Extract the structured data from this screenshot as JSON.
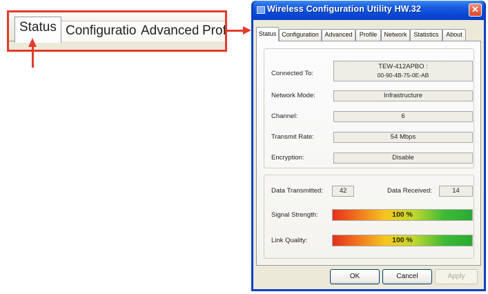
{
  "zoom": {
    "tabs": [
      "Status",
      "Configuration",
      "Advanced",
      "Profi"
    ]
  },
  "window": {
    "title": "Wireless Configuration Utility HW.32",
    "close_glyph": "✕",
    "tabs": [
      "Status",
      "Configuration",
      "Advanced",
      "Profile",
      "Network",
      "Statistics",
      "About"
    ],
    "active_tab": "Status"
  },
  "status": {
    "connected_to_label": "Connected To:",
    "connected_to_line1": "TEW-412APBO :",
    "connected_to_line2": "00-90-4B-75-0E-AB",
    "network_mode_label": "Network Mode:",
    "network_mode": "Infrastructure",
    "channel_label": "Channel:",
    "channel": "6",
    "transmit_rate_label": "Transmit Rate:",
    "transmit_rate": "54 Mbps",
    "encryption_label": "Encryption:",
    "encryption": "Disable"
  },
  "traffic": {
    "data_transmitted_label": "Data Transmitted:",
    "data_transmitted": "42",
    "data_received_label": "Data Received:",
    "data_received": "14",
    "signal_strength_label": "Signal Strength:",
    "signal_strength_text": "100 %",
    "signal_strength_value": 100,
    "link_quality_label": "Link Quality:",
    "link_quality_text": "100 %",
    "link_quality_value": 100
  },
  "buttons": {
    "ok": "OK",
    "cancel": "Cancel",
    "apply": "Apply"
  },
  "colors": {
    "callout": "#e23b2b",
    "titlebar": "#0a47d6"
  },
  "icons": {
    "app": "app-window-icon",
    "close": "close-icon"
  }
}
